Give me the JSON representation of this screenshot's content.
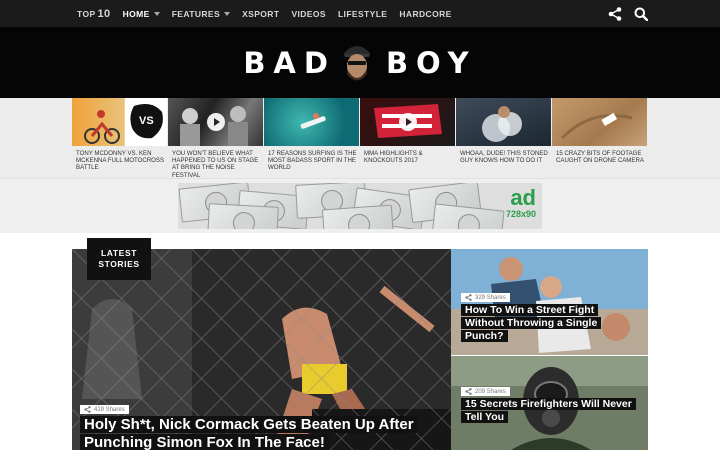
{
  "nav": {
    "items": [
      {
        "label_prefix": "TOP ",
        "label_big": "10",
        "active": false,
        "caret": false
      },
      {
        "label": "HOME",
        "active": true,
        "caret": true
      },
      {
        "label": "FEATURES",
        "active": false,
        "caret": true
      },
      {
        "label": "XSPORT",
        "active": false,
        "caret": false
      },
      {
        "label": "VIDEOS",
        "active": false,
        "caret": false
      },
      {
        "label": "LIFESTYLE",
        "active": false,
        "caret": false
      },
      {
        "label": "HARDCORE",
        "active": false,
        "caret": false
      }
    ],
    "icons": [
      "share-icon",
      "search-icon"
    ]
  },
  "logo": {
    "left": "BAD",
    "right": "BOY"
  },
  "trending": [
    {
      "caption": "TONY MCDONNY VS. KEN MCKENNA FULL MOTOCROSS BATTLE",
      "video": false
    },
    {
      "caption": "YOU WON'T BELIEVE WHAT HAPPENED TO US ON STAGE AT BRING THE NOISE FESTIVAL",
      "video": true
    },
    {
      "caption": "17 REASONS SURFING IS THE MOST BADASS SPORT IN THE WORLD",
      "video": false
    },
    {
      "caption": "MMA HIGHLIGHTS & KNOCKOUTS 2017",
      "video": true
    },
    {
      "caption": "WHOAA, DUDE! THIS STONED GUY KNOWS HOW TO DO IT",
      "video": false
    },
    {
      "caption": "15 CRAZY BITS OF FOOTAGE CAUGHT ON DRONE CAMERA",
      "video": false
    }
  ],
  "ad": {
    "brand": "ad",
    "size": "728x90"
  },
  "latest": {
    "line1": "LATEST",
    "line2": "STORIES"
  },
  "stories": {
    "main": {
      "shares": "419 Shares",
      "title": "Holy Sh*t, Nick Cormack Gets Beaten Up After Punching Simon Fox In The Face!"
    },
    "side1": {
      "shares": "329 Shares",
      "title": "How To Win a Street Fight Without Throwing a Single Punch?"
    },
    "side2": {
      "shares": "209 Shares",
      "title": "15 Secrets Firefighters Will Never Tell You"
    }
  },
  "colors": {
    "nav_bg": "#1b1b1b",
    "header_bg": "#050505",
    "ad_green": "#2a9e4a"
  }
}
